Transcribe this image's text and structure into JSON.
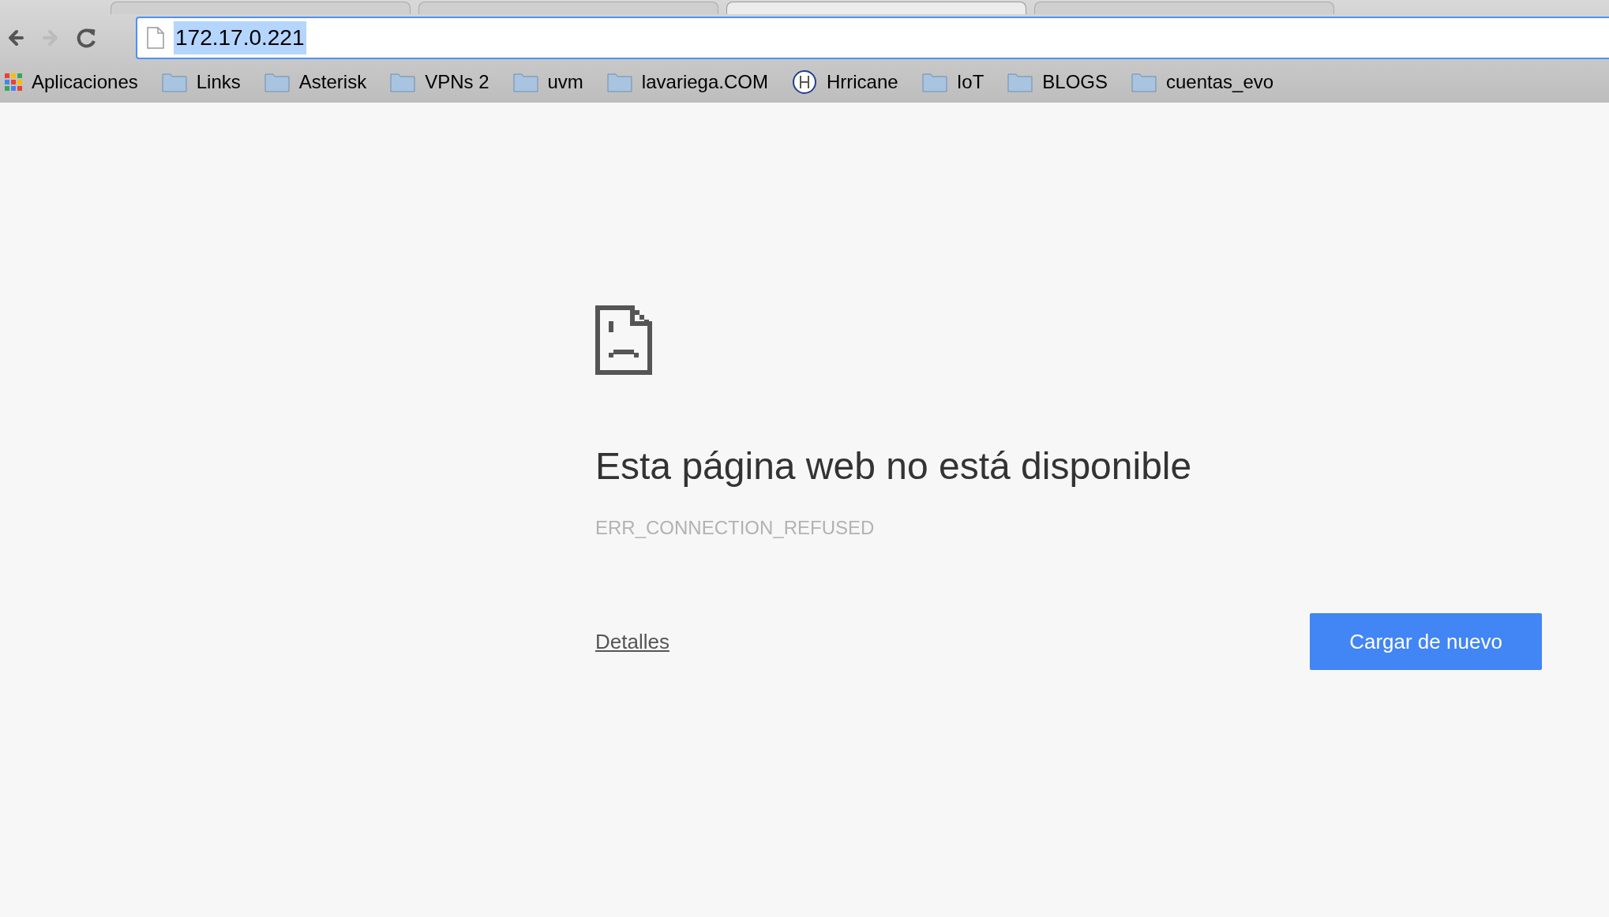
{
  "tabs": [
    {
      "selected": false
    },
    {
      "selected": false
    },
    {
      "selected": true
    },
    {
      "selected": false
    }
  ],
  "nav_buttons": [
    {
      "kind": "back",
      "disabled": false
    },
    {
      "kind": "forward",
      "disabled": true
    },
    {
      "kind": "reload",
      "disabled": false
    }
  ],
  "address_bar": {
    "value": "172.17.0.221",
    "text_selected": true
  },
  "bookmarks": [
    {
      "kind": "apps",
      "label": "Aplicaciones"
    },
    {
      "kind": "folder",
      "label": "Links"
    },
    {
      "kind": "folder",
      "label": "Asterisk"
    },
    {
      "kind": "folder",
      "label": "VPNs 2"
    },
    {
      "kind": "folder",
      "label": "uvm"
    },
    {
      "kind": "folder",
      "label": "lavariega.COM"
    },
    {
      "kind": "site",
      "label": "Hrricane"
    },
    {
      "kind": "folder",
      "label": "IoT"
    },
    {
      "kind": "folder",
      "label": "BLOGS"
    },
    {
      "kind": "folder",
      "label": "cuentas_evo"
    }
  ],
  "error_page": {
    "title": "Esta página web no está disponible",
    "code": "ERR_CONNECTION_REFUSED",
    "details_link": "Detalles",
    "reload_button": "Cargar de nuevo"
  }
}
